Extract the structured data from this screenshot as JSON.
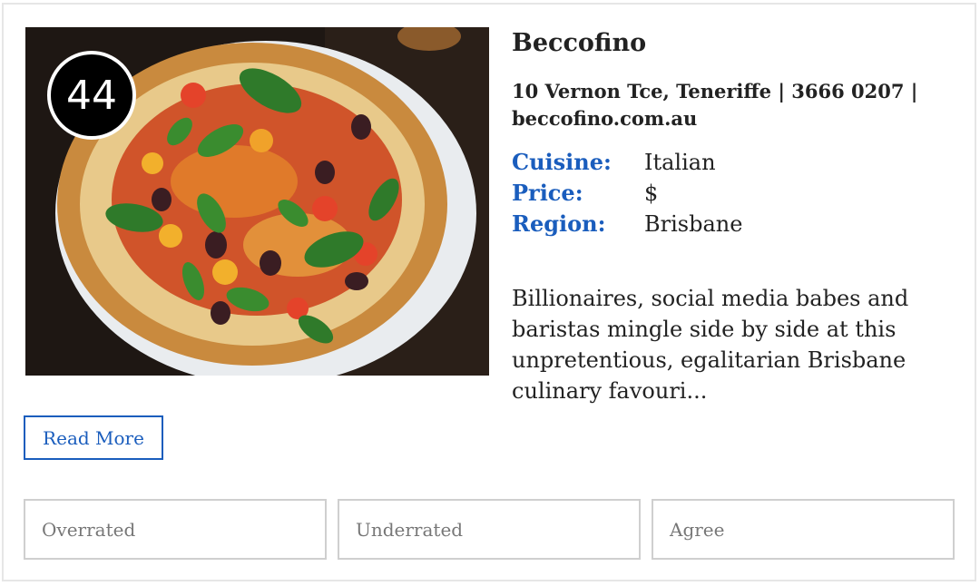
{
  "listing": {
    "rank": "44",
    "name": "Beccofino",
    "address_line": "10 Vernon Tce, Teneriffe | 3666 0207 | beccofino.com.au",
    "details": [
      {
        "label": "Cuisine:",
        "value": "Italian"
      },
      {
        "label": "Price:",
        "value": "$"
      },
      {
        "label": "Region:",
        "value": "Brisbane"
      }
    ],
    "description": "Billionaires, social media babes and baristas mingle side by side at this unpretentious, egalitarian Brisbane culinary favouri...",
    "read_more_label": "Read More"
  },
  "votes": {
    "overrated": "Overrated",
    "underrated": "Underrated",
    "agree": "Agree"
  },
  "colors": {
    "accent": "#1a5dbd",
    "badge_bg": "#000000"
  }
}
